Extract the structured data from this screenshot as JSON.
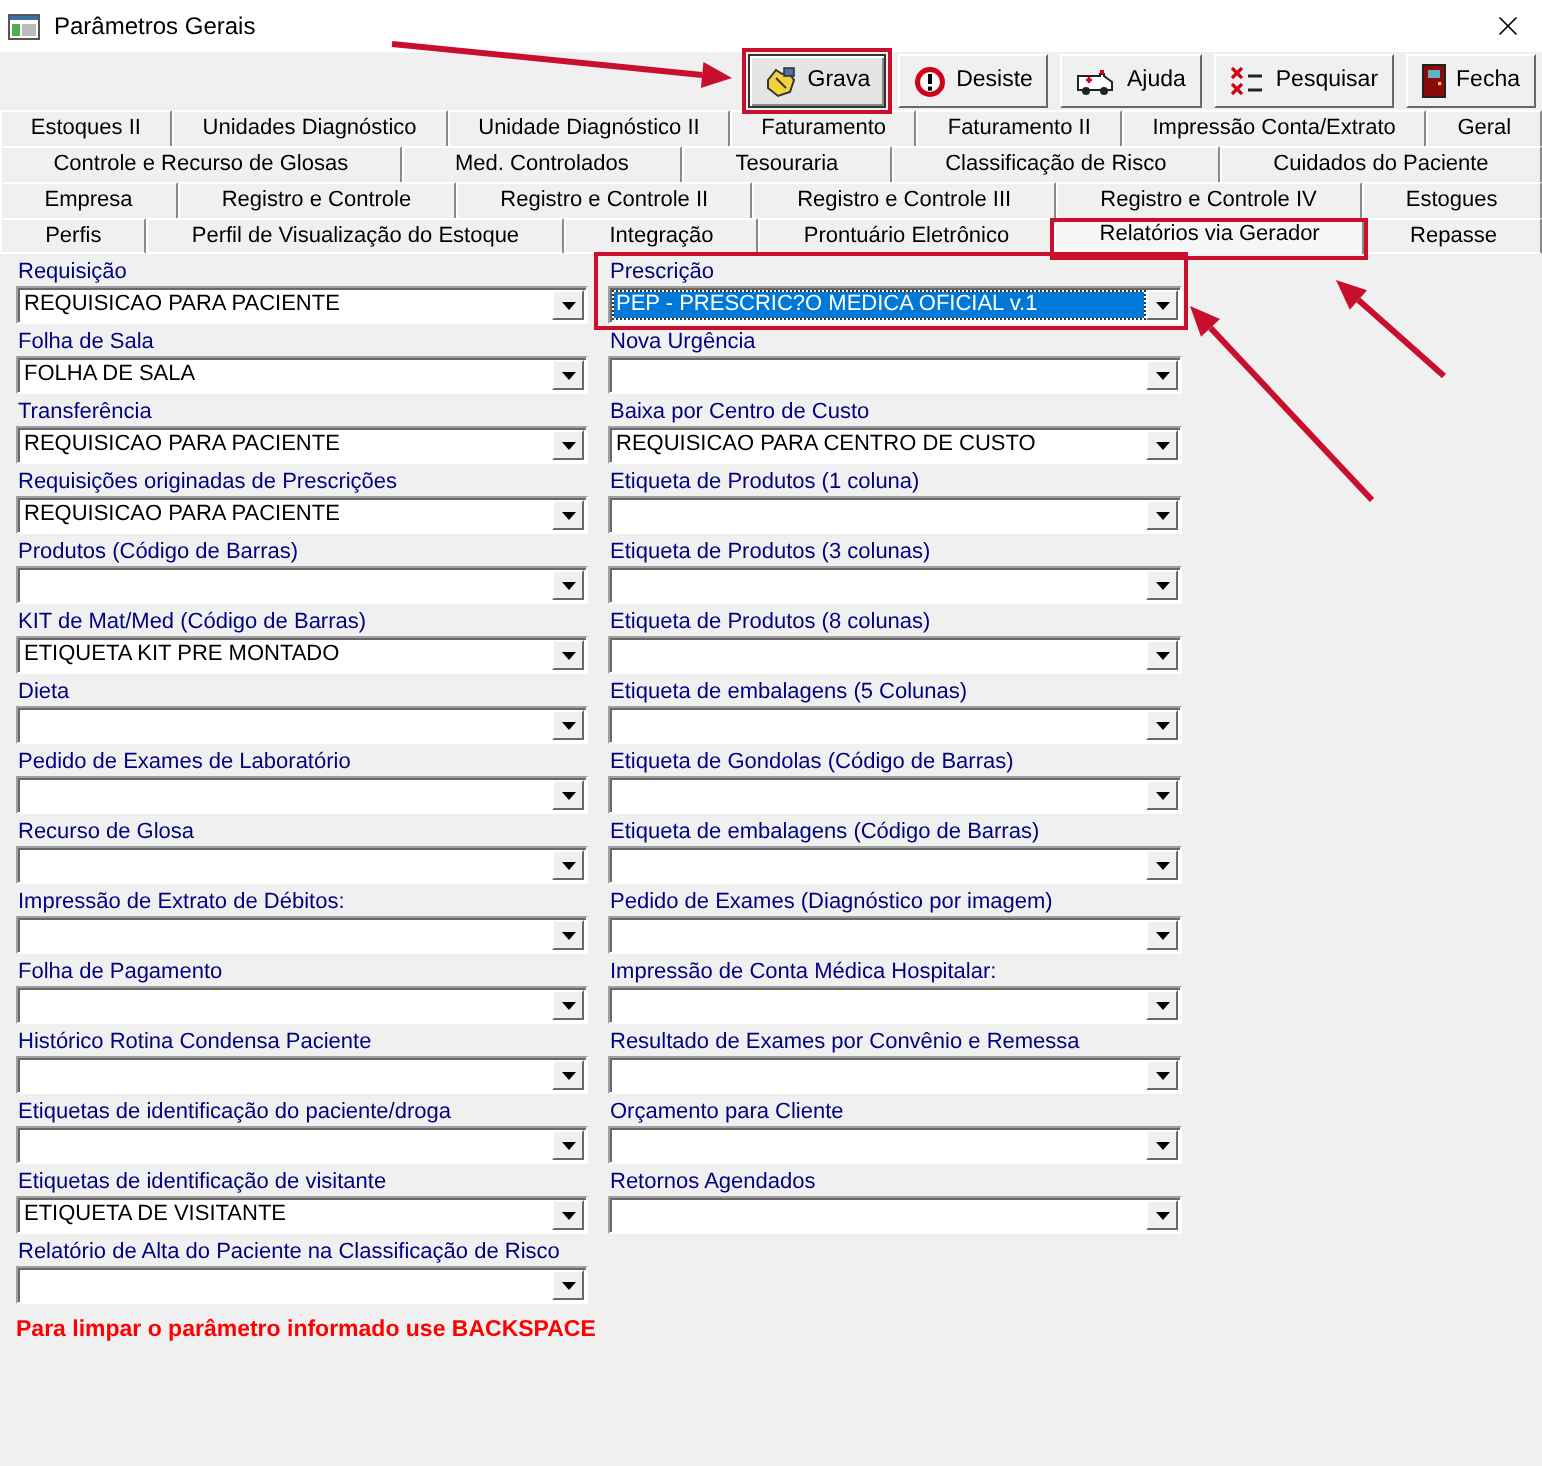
{
  "window": {
    "title": "Parâmetros Gerais"
  },
  "toolbar": [
    {
      "label": "Grava",
      "focused": true,
      "annotated": true
    },
    {
      "label": "Desiste",
      "focused": false,
      "annotated": false
    },
    {
      "label": "Ajuda",
      "focused": false,
      "annotated": false
    },
    {
      "label": "Pesquisar",
      "focused": false,
      "annotated": false
    },
    {
      "label": "Fecha",
      "focused": false,
      "annotated": false
    }
  ],
  "tab_rows": [
    [
      {
        "label": "Estoques II",
        "selected": false,
        "annotated": false
      },
      {
        "label": "Unidades Diagnóstico",
        "selected": false,
        "annotated": false
      },
      {
        "label": "Unidade Diagnóstico II",
        "selected": false,
        "annotated": false
      },
      {
        "label": "Faturamento",
        "selected": false,
        "annotated": false
      },
      {
        "label": "Faturamento II",
        "selected": false,
        "annotated": false
      },
      {
        "label": "Impressão Conta/Extrato",
        "selected": false,
        "annotated": false
      },
      {
        "label": "Geral",
        "selected": false,
        "annotated": false
      }
    ],
    [
      {
        "label": "Controle e Recurso de Glosas",
        "selected": false,
        "annotated": false
      },
      {
        "label": "Med. Controlados",
        "selected": false,
        "annotated": false
      },
      {
        "label": "Tesouraria",
        "selected": false,
        "annotated": false
      },
      {
        "label": "Classificação de Risco",
        "selected": false,
        "annotated": false
      },
      {
        "label": "Cuidados do Paciente",
        "selected": false,
        "annotated": false
      }
    ],
    [
      {
        "label": "Empresa",
        "selected": false,
        "annotated": false
      },
      {
        "label": "Registro e Controle",
        "selected": false,
        "annotated": false
      },
      {
        "label": "Registro e Controle II",
        "selected": false,
        "annotated": false
      },
      {
        "label": "Registro e Controle III",
        "selected": false,
        "annotated": false
      },
      {
        "label": "Registro e Controle IV",
        "selected": false,
        "annotated": false
      },
      {
        "label": "Estogues",
        "selected": false,
        "annotated": false
      }
    ],
    [
      {
        "label": "Perfis",
        "selected": false,
        "annotated": false
      },
      {
        "label": "Perfil de Visualização do Estoque",
        "selected": false,
        "annotated": false
      },
      {
        "label": "Integração",
        "selected": false,
        "annotated": false
      },
      {
        "label": "Prontuário Eletrônico",
        "selected": false,
        "annotated": false
      },
      {
        "label": "Relatórios via Gerador",
        "selected": true,
        "annotated": true
      },
      {
        "label": "Repasse",
        "selected": false,
        "annotated": false
      }
    ]
  ],
  "form": {
    "left": [
      {
        "label": "Requisição",
        "value": "REQUISICAO PARA PACIENTE",
        "focused": false,
        "annotated": false
      },
      {
        "label": "Folha de Sala",
        "value": "FOLHA DE SALA",
        "focused": false,
        "annotated": false
      },
      {
        "label": "Transferência",
        "value": "REQUISICAO PARA PACIENTE",
        "focused": false,
        "annotated": false
      },
      {
        "label": "Requisições originadas de Prescrições",
        "value": "REQUISICAO PARA PACIENTE",
        "focused": false,
        "annotated": false
      },
      {
        "label": "Produtos (Código de Barras)",
        "focused": false,
        "annotated": false
      },
      {
        "label": "KIT de Mat/Med (Código de Barras)",
        "value": "ETIQUETA KIT PRE MONTADO",
        "focused": false,
        "annotated": false
      },
      {
        "label": "Dieta",
        "focused": false,
        "annotated": false
      },
      {
        "label": "Pedido de Exames de Laboratório",
        "focused": false,
        "annotated": false
      },
      {
        "label": "Recurso de Glosa",
        "focused": false,
        "annotated": false
      },
      {
        "label": "Impressão de Extrato de Débitos:",
        "focused": false,
        "annotated": false
      },
      {
        "label": "Folha de Pagamento",
        "focused": false,
        "annotated": false
      },
      {
        "label": "Histórico Rotina Condensa Paciente",
        "focused": false,
        "annotated": false
      },
      {
        "label": "Etiquetas de identificação do paciente/droga",
        "focused": false,
        "annotated": false
      },
      {
        "label": "Etiquetas de identificação de visitante",
        "value": "ETIQUETA DE VISITANTE",
        "focused": false,
        "annotated": false
      },
      {
        "label": "Relatório de Alta do Paciente na Classificação de Risco",
        "focused": false,
        "annotated": false
      }
    ],
    "right": [
      {
        "label": "Prescrição",
        "value": "PEP - PRESCRIC?O MEDICA OFICIAL v.1",
        "focused": true,
        "annotated": true
      },
      {
        "label": "Nova Urgência",
        "focused": false,
        "annotated": false
      },
      {
        "label": "Baixa por Centro de Custo",
        "value": "REQUISICAO PARA CENTRO DE CUSTO",
        "focused": false,
        "annotated": false
      },
      {
        "label": "Etiqueta de Produtos (1 coluna)",
        "focused": false,
        "annotated": false
      },
      {
        "label": "Etiqueta de Produtos (3 colunas)",
        "focused": false,
        "annotated": false
      },
      {
        "label": "Etiqueta de Produtos (8 colunas)",
        "focused": false,
        "annotated": false
      },
      {
        "label": "Etiqueta de embalagens (5 Colunas)",
        "focused": false,
        "annotated": false
      },
      {
        "label": "Etiqueta de Gondolas (Código de Barras)",
        "focused": false,
        "annotated": false
      },
      {
        "label": "Etiqueta de embalagens (Código de Barras)",
        "focused": false,
        "annotated": false
      },
      {
        "label": "Pedido de Exames (Diagnóstico por imagem)",
        "focused": false,
        "annotated": false
      },
      {
        "label": "Impressão de Conta Médica Hospitalar:",
        "focused": false,
        "annotated": false
      },
      {
        "label": "Resultado de Exames por Convênio e Remessa",
        "focused": false,
        "annotated": false
      },
      {
        "label": "Orçamento para Cliente",
        "focused": false,
        "annotated": false
      },
      {
        "label": "Retornos Agendados",
        "focused": false,
        "annotated": false
      }
    ]
  },
  "note": "Para limpar o parâmetro informado use BACKSPACE"
}
